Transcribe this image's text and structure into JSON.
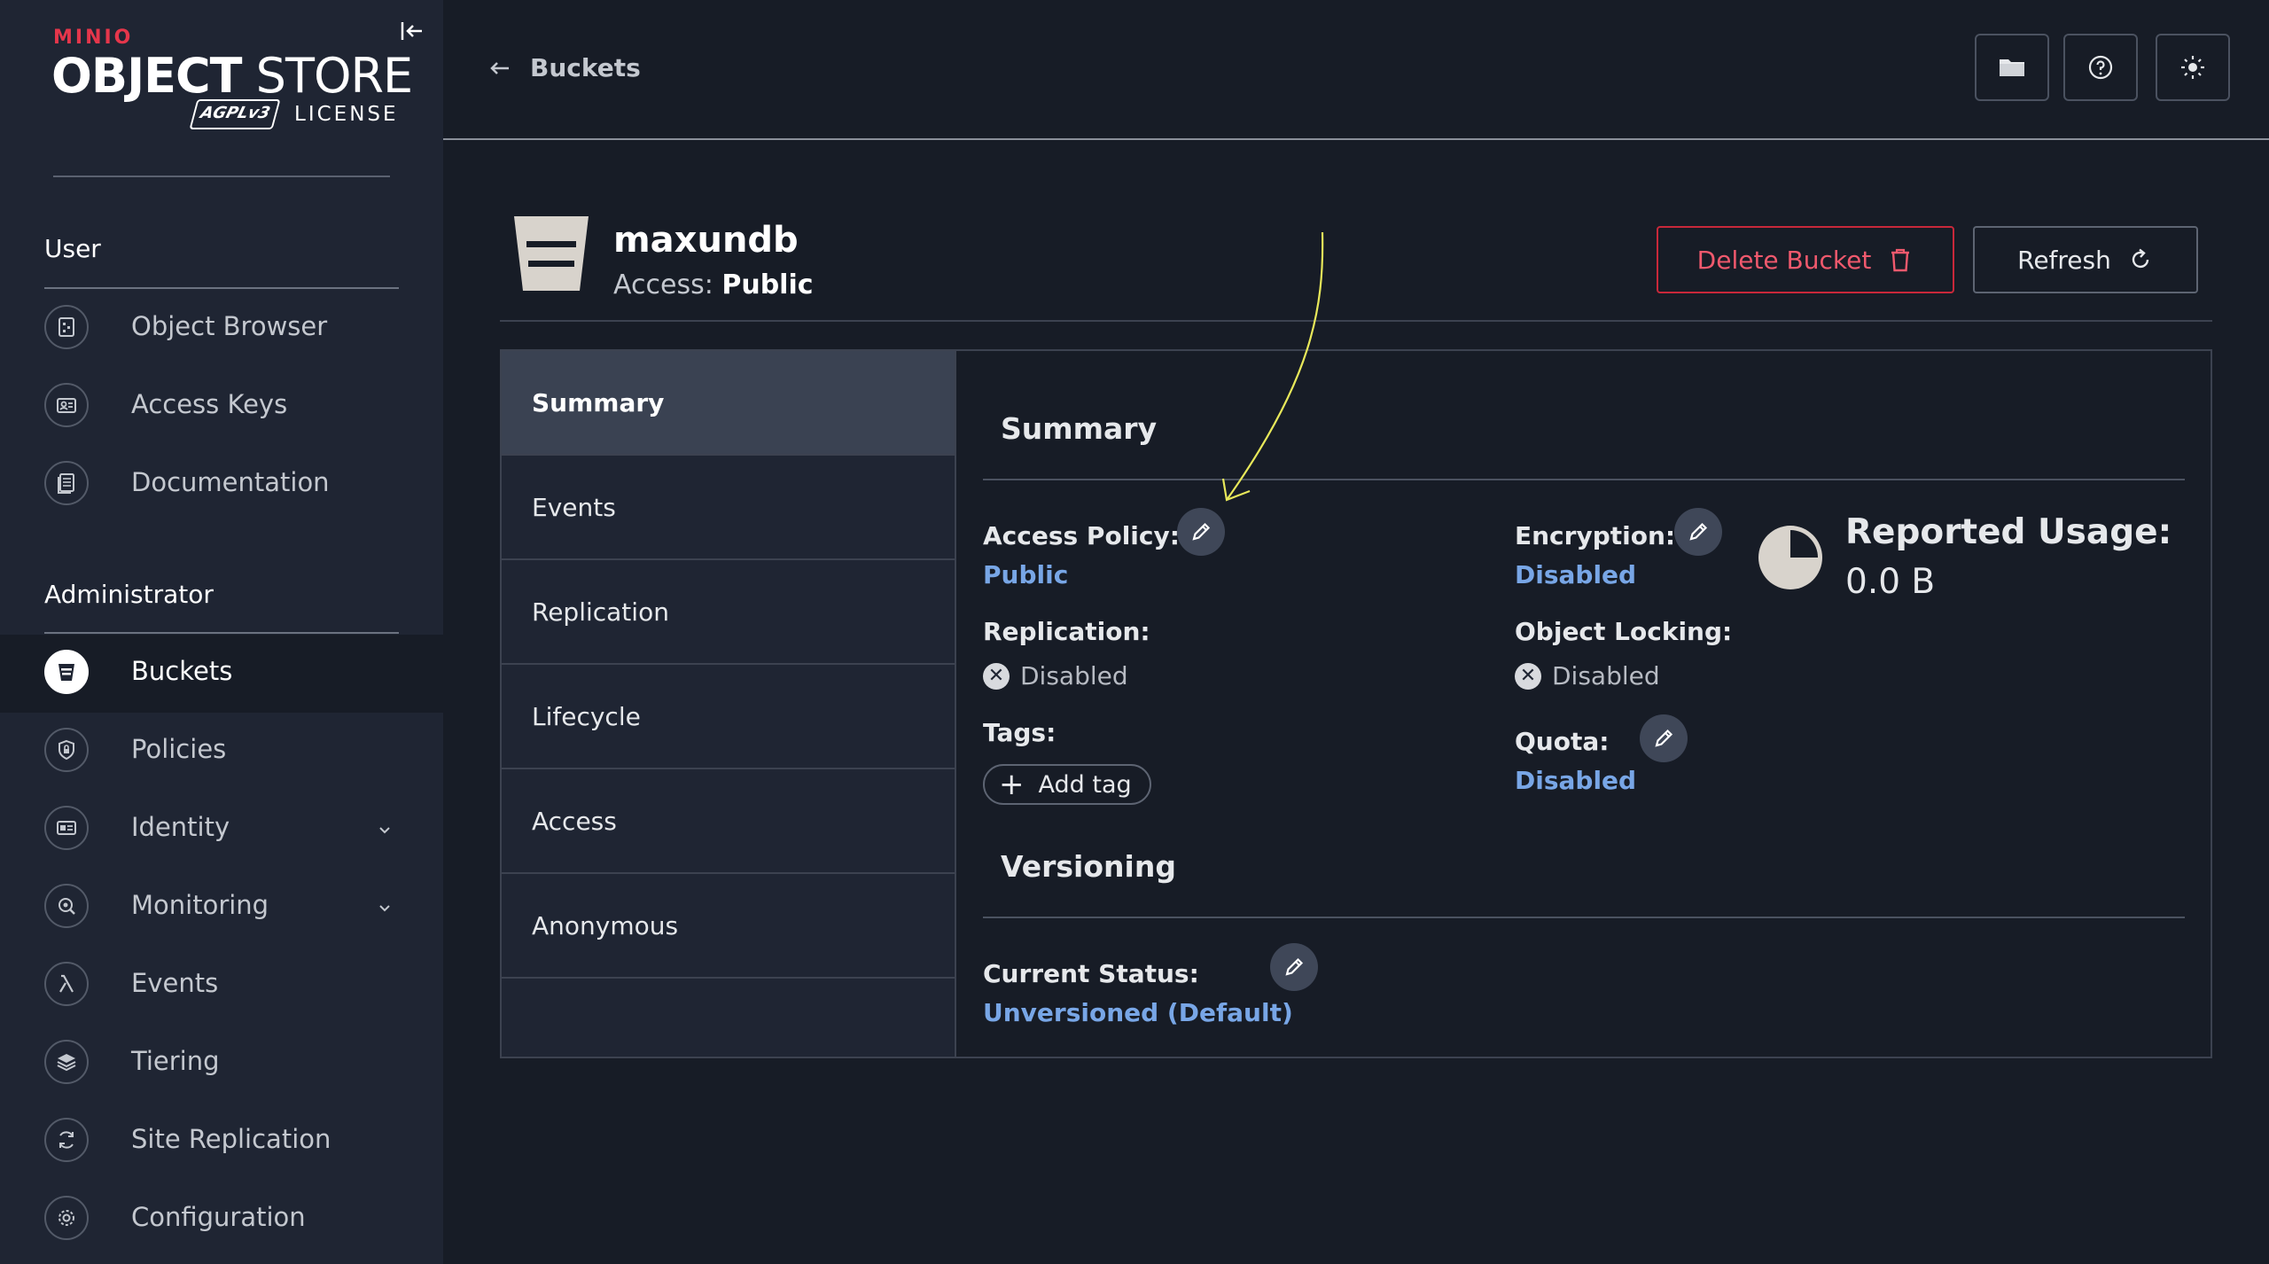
{
  "sidebar": {
    "logo": {
      "brand": "MINIO",
      "product_bold": "OBJECT",
      "product_light": " STORE",
      "badge": "AGPLv3",
      "license": "LICENSE"
    },
    "user_section": "User",
    "user_items": [
      {
        "label": "Object Browser",
        "icon": "object-browser-icon"
      },
      {
        "label": "Access Keys",
        "icon": "access-keys-icon"
      },
      {
        "label": "Documentation",
        "icon": "documentation-icon"
      }
    ],
    "admin_section": "Administrator",
    "admin_items": [
      {
        "label": "Buckets",
        "icon": "bucket-icon",
        "active": true
      },
      {
        "label": "Policies",
        "icon": "policies-icon"
      },
      {
        "label": "Identity",
        "icon": "identity-icon",
        "expandable": true
      },
      {
        "label": "Monitoring",
        "icon": "monitoring-icon",
        "expandable": true
      },
      {
        "label": "Events",
        "icon": "lambda-icon"
      },
      {
        "label": "Tiering",
        "icon": "tiering-icon"
      },
      {
        "label": "Site Replication",
        "icon": "site-replication-icon"
      },
      {
        "label": "Configuration",
        "icon": "gear-icon"
      }
    ]
  },
  "topbar": {
    "back_label": "Buckets",
    "buttons": [
      "folder-icon",
      "help-icon",
      "theme-toggle-icon"
    ]
  },
  "bucket": {
    "name": "maxundb",
    "access_label": "Access: ",
    "access_value": "Public",
    "delete_label": "Delete Bucket",
    "refresh_label": "Refresh"
  },
  "tabs": [
    "Summary",
    "Events",
    "Replication",
    "Lifecycle",
    "Access",
    "Anonymous"
  ],
  "active_tab": "Summary",
  "summary": {
    "title": "Summary",
    "access_policy_label": "Access Policy:",
    "access_policy_value": "Public",
    "replication_label": "Replication:",
    "replication_value": "Disabled",
    "tags_label": "Tags:",
    "add_tag_label": "Add tag",
    "encryption_label": "Encryption:",
    "encryption_value": "Disabled",
    "object_locking_label": "Object Locking:",
    "object_locking_value": "Disabled",
    "quota_label": "Quota:",
    "quota_value": "Disabled",
    "usage_label": "Reported Usage:",
    "usage_value": "0.0 B"
  },
  "versioning": {
    "title": "Versioning",
    "status_label": "Current Status:",
    "status_value": "Unversioned (Default)"
  },
  "colors": {
    "background": "#171c26",
    "sidebar": "#1f2533",
    "link": "#78a6e6",
    "danger": "#c8283a",
    "annotation": "#e8e85a"
  }
}
